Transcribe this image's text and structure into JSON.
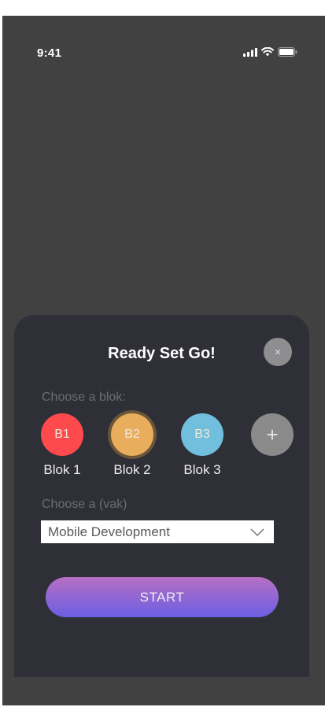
{
  "status_bar": {
    "time": "9:41",
    "icons": [
      "signal-icon",
      "wifi-icon",
      "battery-icon"
    ]
  },
  "sheet": {
    "title": "Ready Set Go!",
    "close_symbol": "×",
    "choose_blok_label": "Choose a blok:",
    "bloks": [
      {
        "code": "B1",
        "name": "Blok 1",
        "color": "#fe4a4d",
        "selected": false
      },
      {
        "code": "B2",
        "name": "Blok 2",
        "color": "#e8ae5d",
        "selected": true
      },
      {
        "code": "B3",
        "name": "Blok 3",
        "color": "#71bfdc",
        "selected": false
      }
    ],
    "add_symbol": "+",
    "choose_vak_label": "Choose a (vak)",
    "vak_select": {
      "value": "Mobile Development",
      "icon": "chevron-down-icon"
    },
    "start_label": "START"
  },
  "colors": {
    "background": "#414141",
    "sheet": "#2f2f38",
    "start_gradient_top": "#b86fc4",
    "start_gradient_bottom": "#6a5fe3"
  }
}
